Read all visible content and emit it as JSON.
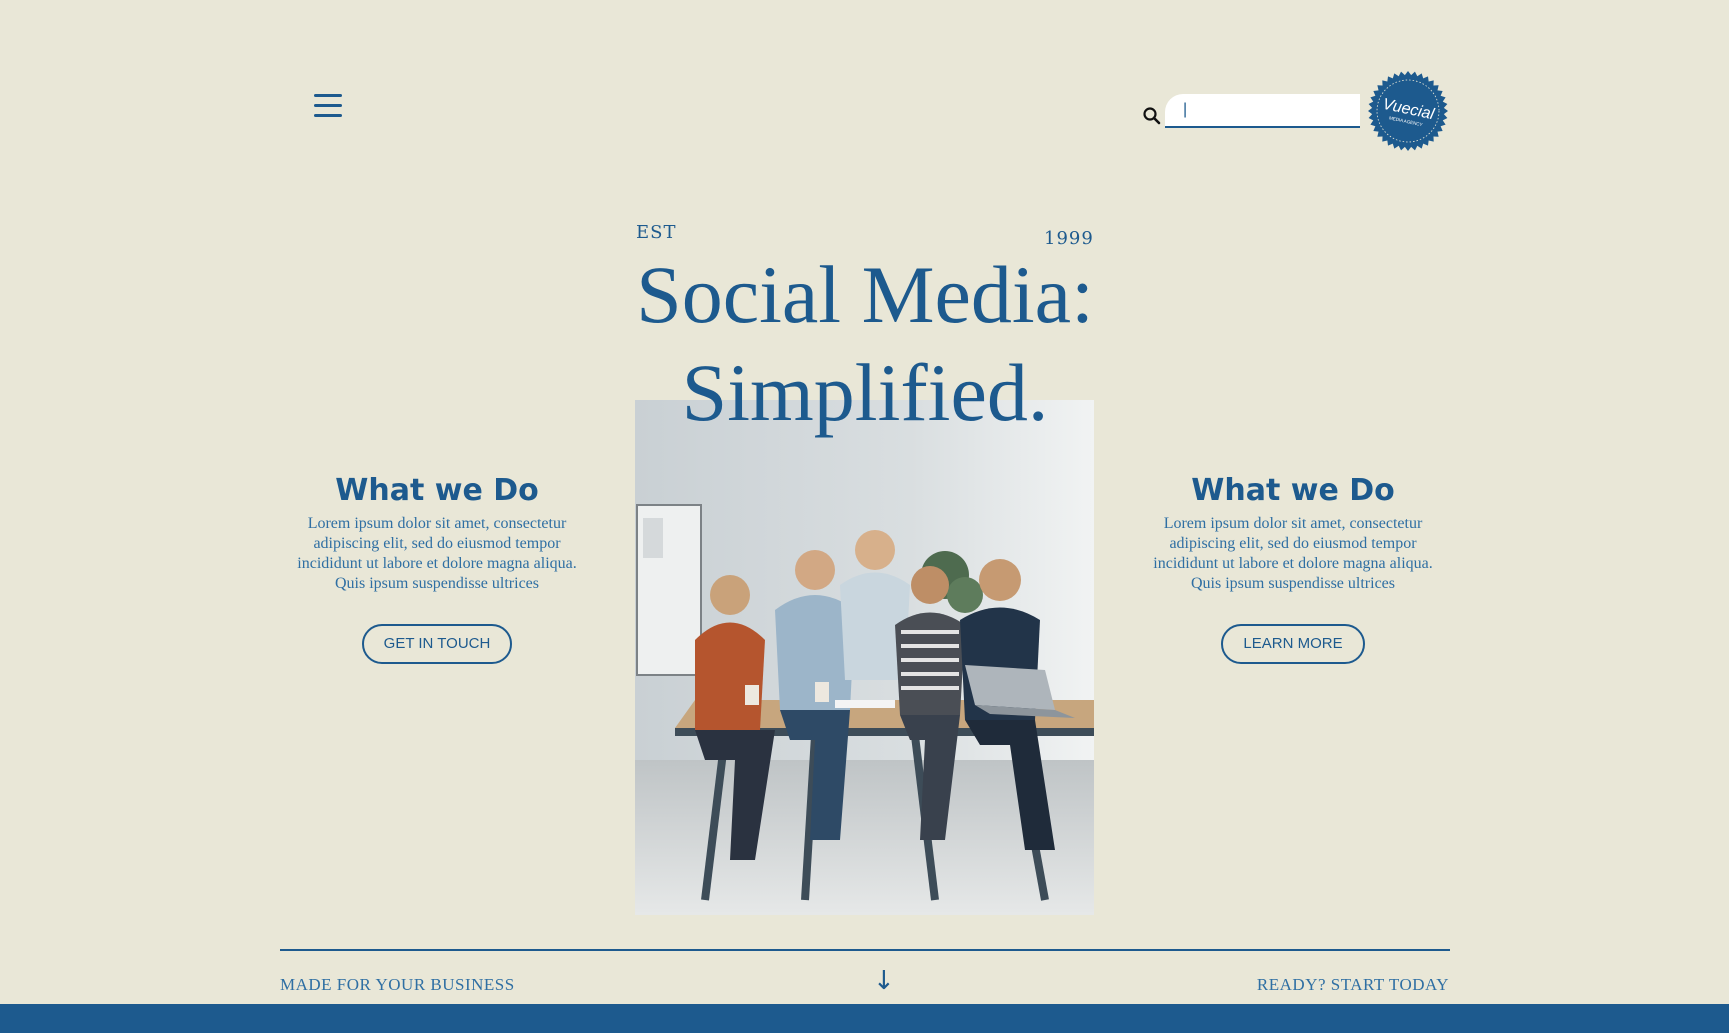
{
  "header": {
    "menu_icon": "hamburger-menu-icon",
    "search_icon": "magnifier-icon",
    "search": {
      "value": "|",
      "placeholder": ""
    },
    "logo": {
      "name": "Vuecial",
      "tagline": "MEDIA AGENCY"
    }
  },
  "hero": {
    "est_label": "EST",
    "year": "1999",
    "title_line1": "Social Media:",
    "title_line2": "Simplified.",
    "image_icon": "team-meeting-photo"
  },
  "left_block": {
    "heading": "What we Do",
    "text": "Lorem ipsum dolor sit amet, consectetur adipiscing elit, sed do eiusmod tempor incididunt ut labore et dolore magna aliqua. Quis ipsum suspendisse ultrices",
    "button": "GET IN TOUCH"
  },
  "right_block": {
    "heading": "What we Do",
    "text": "Lorem ipsum dolor sit amet, consectetur adipiscing elit, sed do eiusmod tempor incididunt ut labore et dolore magna aliqua. Quis ipsum suspendisse ultrices",
    "button": "LEARN MORE"
  },
  "footer": {
    "left_text": "MADE FOR YOUR BUSINESS",
    "arrow": "↓",
    "arrow_icon": "arrow-down-icon",
    "right_text": "READY? START TODAY"
  },
  "colors": {
    "background": "#E9E7D7",
    "primary": "#1D5A8E",
    "text_secondary": "#2F6FA3"
  }
}
